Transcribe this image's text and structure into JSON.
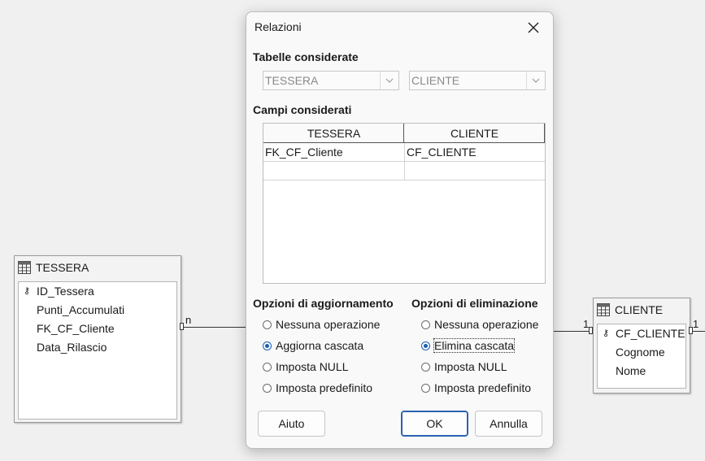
{
  "background": {
    "left_table": {
      "name": "TESSERA",
      "fields": [
        {
          "name": "ID_Tessera",
          "key": true
        },
        {
          "name": "Punti_Accumulati",
          "key": false
        },
        {
          "name": "FK_CF_Cliente",
          "key": false
        },
        {
          "name": "Data_Rilascio",
          "key": false
        }
      ]
    },
    "right_table": {
      "name": "CLIENTE",
      "fields": [
        {
          "name": "CF_CLIENTE",
          "key": true
        },
        {
          "name": "Cognome",
          "key": false
        },
        {
          "name": "Nome",
          "key": false
        }
      ]
    },
    "relation_labels": {
      "left": "n",
      "right": "1",
      "right_far": "1"
    },
    "key_glyph": "⚷"
  },
  "dialog": {
    "title": "Relazioni",
    "close_icon": "close-icon",
    "tables_heading": "Tabelle considerate",
    "combo_left": "TESSERA",
    "combo_right": "CLIENTE",
    "fields_heading": "Campi considerati",
    "grid": {
      "columns": [
        "TESSERA",
        "CLIENTE"
      ],
      "rows": [
        [
          "FK_CF_Cliente",
          "CF_CLIENTE"
        ],
        [
          "",
          ""
        ]
      ]
    },
    "update_heading": "Opzioni di aggiornamento",
    "update_options": [
      "Nessuna operazione",
      "Aggiorna cascata",
      "Imposta NULL",
      "Imposta predefinito"
    ],
    "update_selected": 1,
    "delete_heading": "Opzioni di eliminazione",
    "delete_options": [
      "Nessuna operazione",
      "Elimina cascata",
      "Imposta NULL",
      "Imposta predefinito"
    ],
    "delete_selected": 1,
    "buttons": {
      "help": "Aiuto",
      "ok": "OK",
      "cancel": "Annulla"
    },
    "colors": {
      "accent": "#1a5fb4"
    }
  }
}
